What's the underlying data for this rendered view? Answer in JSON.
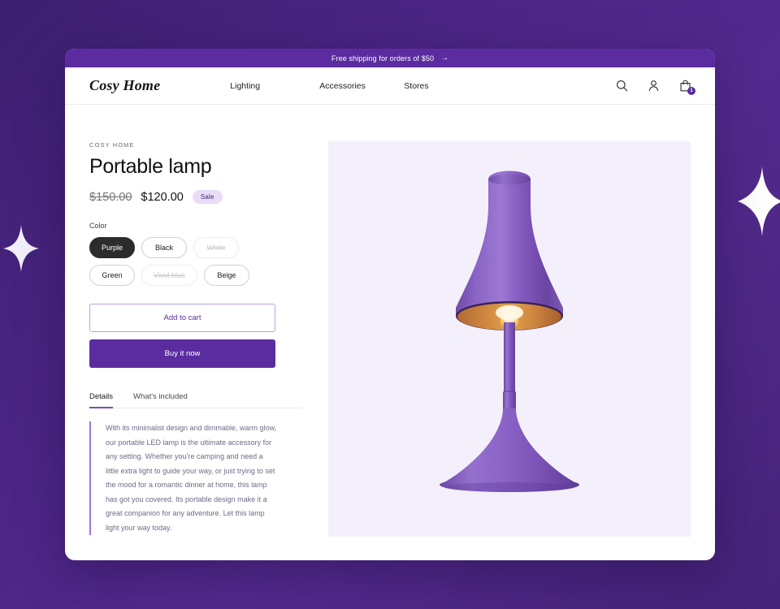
{
  "theme": {
    "brand_purple": "#5a2ca0",
    "page_bg_start": "#3d2070",
    "page_bg_end": "#452378",
    "image_panel_bg": "#f4f0fb",
    "badge_bg": "#e7ddf7",
    "accent_bar": "#9b7cd4"
  },
  "announcement": {
    "text": "Free shipping for orders of $50",
    "arrow": "→"
  },
  "header": {
    "logo": "Cosy Home",
    "nav": [
      {
        "label": "Lighting"
      },
      {
        "label": "Accessories"
      },
      {
        "label": "Stores"
      }
    ],
    "icons": [
      {
        "name": "search-icon"
      },
      {
        "name": "account-icon"
      },
      {
        "name": "shopping-bag-icon"
      }
    ],
    "cart_count": "1"
  },
  "product": {
    "vendor": "COSY HOME",
    "title": "Portable lamp",
    "price_compare": "$150.00",
    "price_current": "$120.00",
    "sale_badge": "Sale",
    "option_label": "Color",
    "colors": [
      {
        "label": "Purple",
        "state": "selected"
      },
      {
        "label": "Black",
        "state": "available"
      },
      {
        "label": "White",
        "state": "disabled"
      },
      {
        "label": "Green",
        "state": "available"
      },
      {
        "label": "Vivid blue",
        "state": "disabled"
      },
      {
        "label": "Beige",
        "state": "available"
      }
    ],
    "add_to_cart": "Add to cart",
    "buy_it_now": "Buy it now",
    "tabs": [
      {
        "label": "Details",
        "active": true
      },
      {
        "label": "What's included",
        "active": false
      }
    ],
    "description": "With its minimalist design and dimmable, warm glow, our portable LED lamp is the ultimate accessory for any setting. Whether you’re camping and need a little extra light to guide your way, or just trying to set the mood for a romantic dinner at home, this lamp has got you covered. Its portable design make it a great companion for any adventure. Let this lamp light your way today.",
    "image_alt": "purple-portable-lamp"
  },
  "decor": {
    "sparkles": [
      {
        "name": "sparkle-right",
        "size": "large"
      },
      {
        "name": "sparkle-left",
        "size": "small"
      }
    ]
  }
}
